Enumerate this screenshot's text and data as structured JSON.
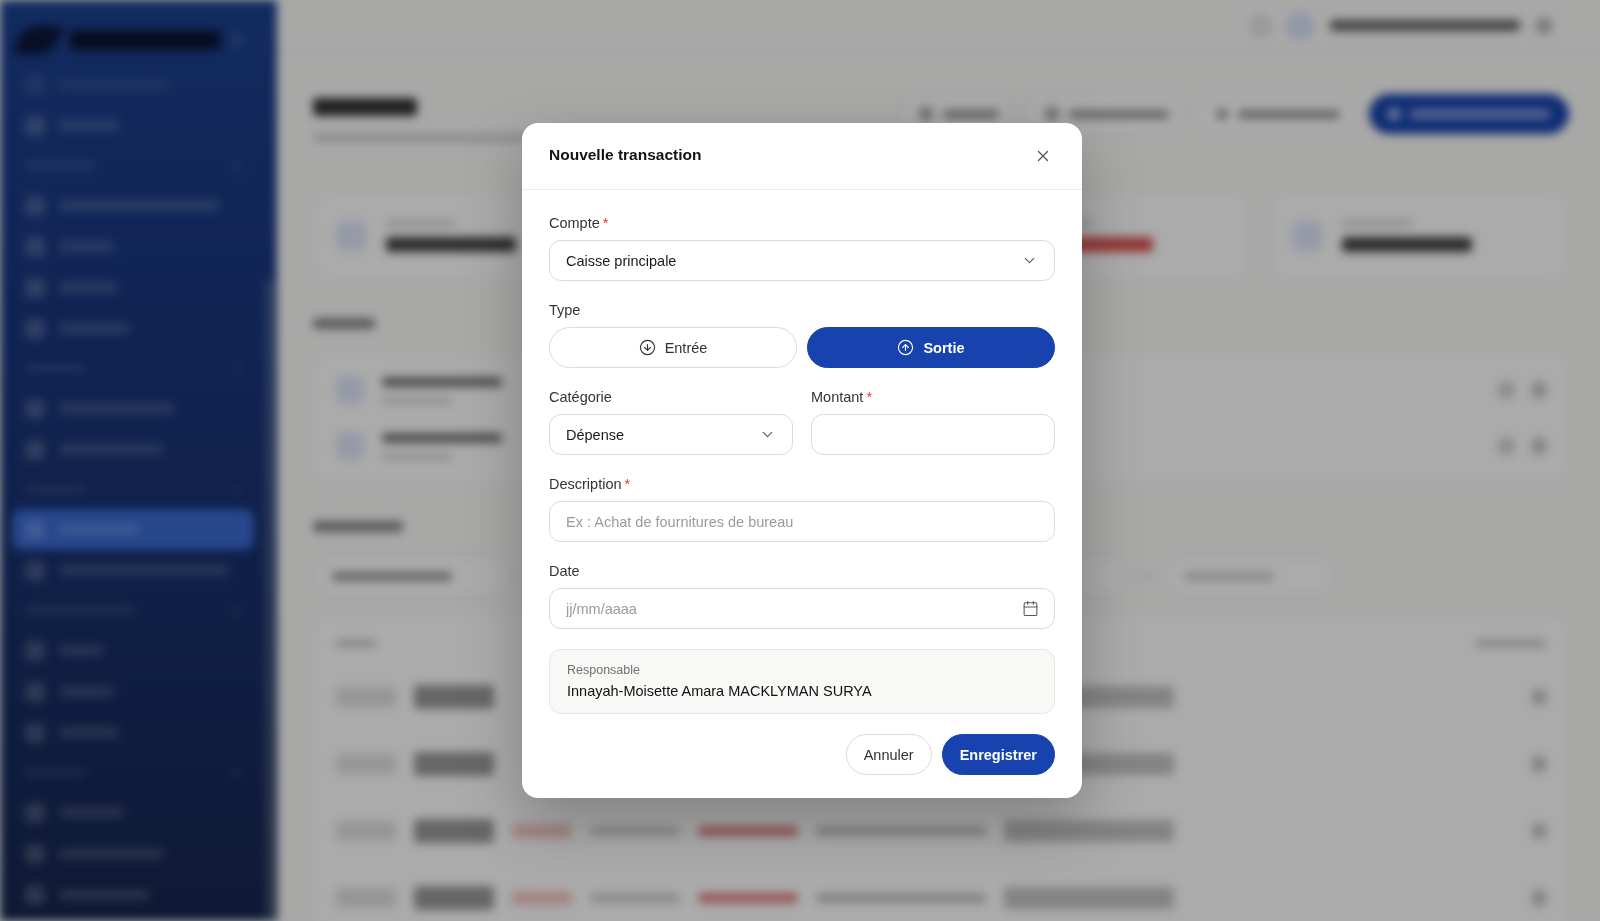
{
  "dialog": {
    "title": "Nouvelle transaction",
    "account": {
      "label": "Compte",
      "required_mark": "*",
      "value": "Caisse principale"
    },
    "type": {
      "label": "Type",
      "options": [
        {
          "label": "Entrée",
          "kind": "in",
          "selected": false
        },
        {
          "label": "Sortie",
          "kind": "out",
          "selected": true
        }
      ]
    },
    "category": {
      "label": "Catégorie",
      "value": "Dépense"
    },
    "amount": {
      "label": "Montant",
      "required_mark": "*"
    },
    "description": {
      "label": "Description",
      "required_mark": "*",
      "placeholder": "Ex : Achat de fournitures de bureau"
    },
    "date": {
      "label": "Date",
      "placeholder": "jj/mm/aaaa"
    },
    "responsible": {
      "label": "Responsable",
      "value": "Innayah-Moisette Amara MACKLYMAN SURYA"
    },
    "buttons": [
      {
        "label": "Annuler",
        "kind": "secondary"
      },
      {
        "label": "Enregistrer",
        "kind": "primary"
      }
    ]
  }
}
